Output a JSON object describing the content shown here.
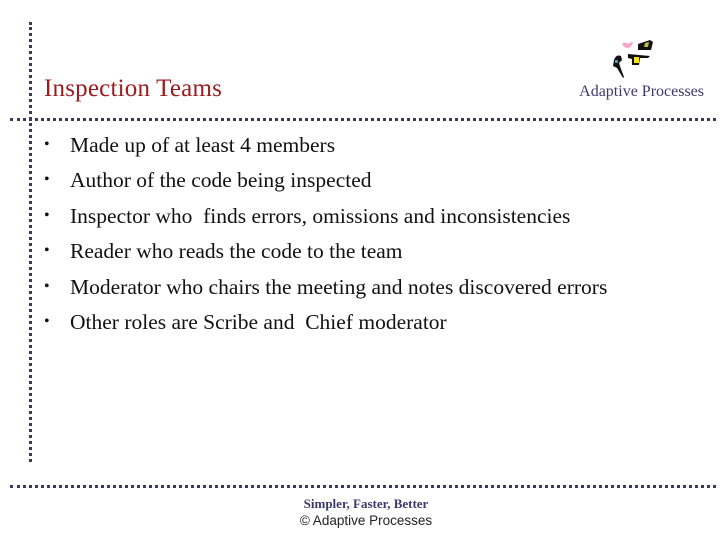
{
  "slide": {
    "title": "Inspection Teams",
    "brand": "Adaptive Processes",
    "logo_icon": "adaptive-processes-logo",
    "bullets": [
      "Made up of at least 4 members",
      "Author of the code being inspected",
      "Inspector who  finds errors, omissions and inconsistencies",
      "Reader who reads the code to the team",
      "Moderator who chairs the meeting and notes discovered errors",
      "Other roles are Scribe and  Chief moderator"
    ],
    "bullet_glyph": "•",
    "footer": {
      "tagline": "Simpler, Faster, Better",
      "copyright": "© Adaptive Processes"
    },
    "colors": {
      "title": "#9b1b1e",
      "brand": "#3a3a6e",
      "rules": "#3a3a5c"
    }
  }
}
